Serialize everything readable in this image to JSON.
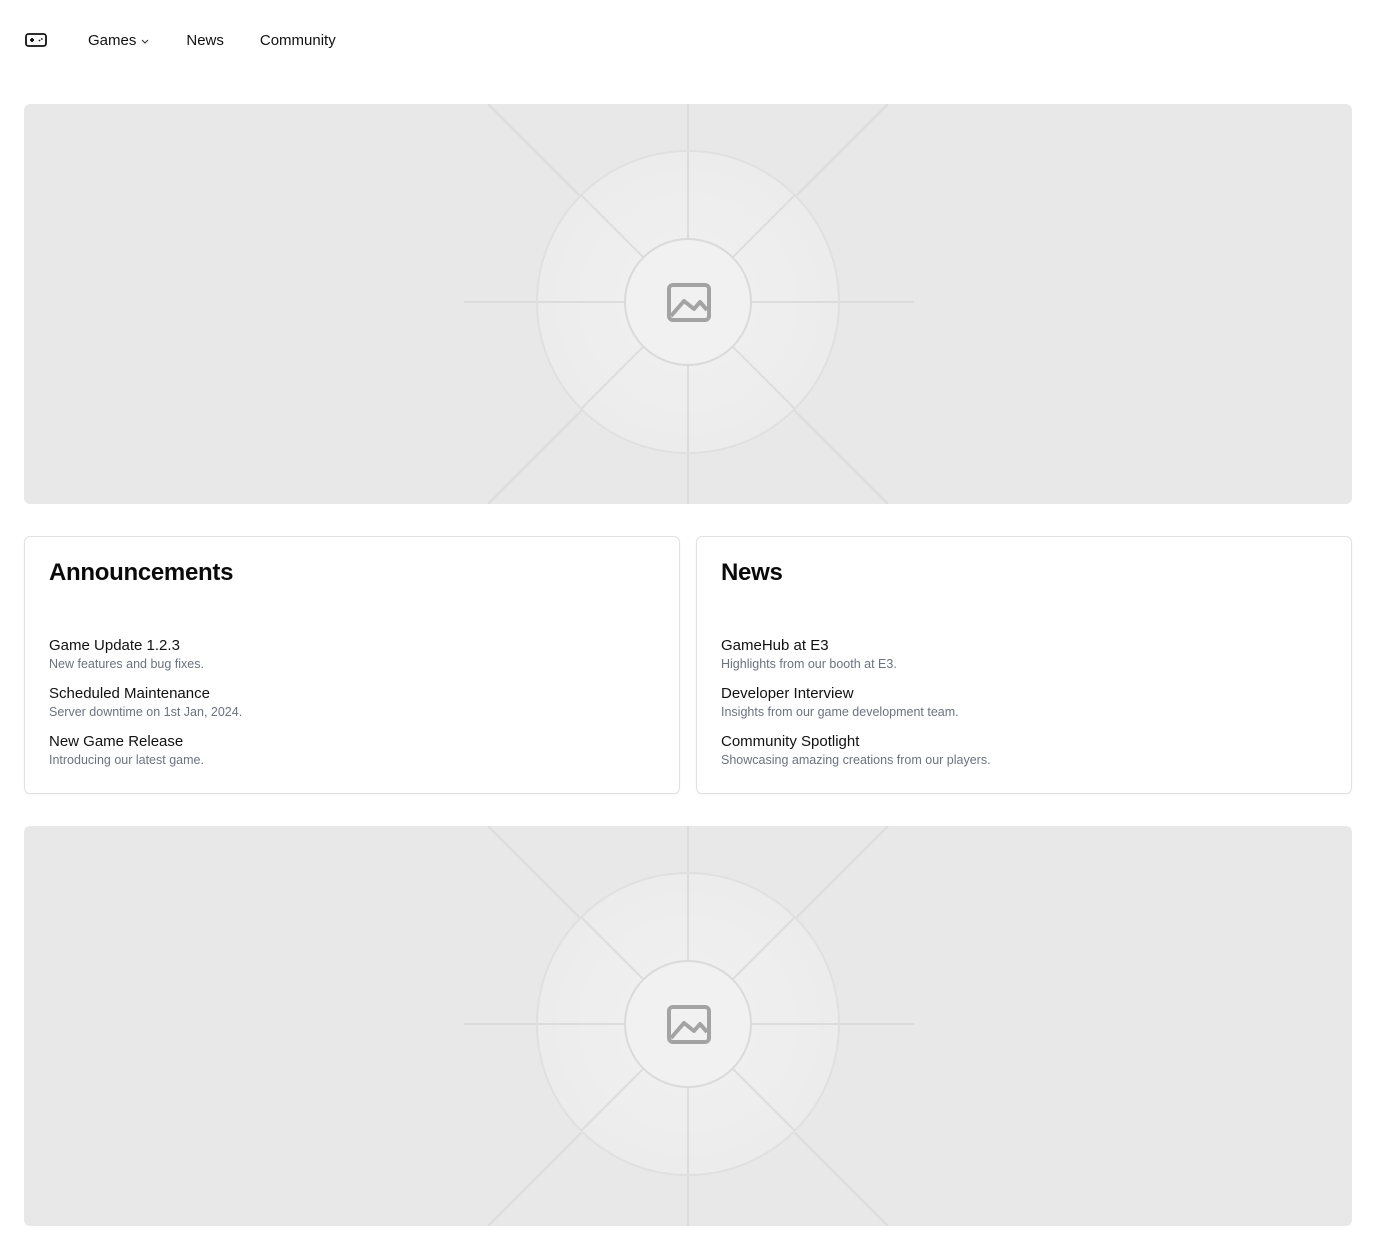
{
  "header": {
    "logo_icon": "gamepad-icon",
    "nav": [
      {
        "label": "Games",
        "has_dropdown": true
      },
      {
        "label": "News"
      },
      {
        "label": "Community"
      }
    ]
  },
  "hero_top": {
    "icon": "image-placeholder-icon"
  },
  "announcements": {
    "title": "Announcements",
    "items": [
      {
        "title": "Game Update 1.2.3",
        "desc": "New features and bug fixes."
      },
      {
        "title": "Scheduled Maintenance",
        "desc": "Server downtime on 1st Jan, 2024."
      },
      {
        "title": "New Game Release",
        "desc": "Introducing our latest game."
      }
    ]
  },
  "news": {
    "title": "News",
    "items": [
      {
        "title": "GameHub at E3",
        "desc": "Highlights from our booth at E3."
      },
      {
        "title": "Developer Interview",
        "desc": "Insights from our game development team."
      },
      {
        "title": "Community Spotlight",
        "desc": "Showcasing amazing creations from our players."
      }
    ]
  },
  "hero_bottom": {
    "icon": "image-placeholder-icon"
  },
  "colors": {
    "placeholder_bg": "#e8e8e8",
    "muted_text": "#6b7280",
    "card_border": "#e2e2e2"
  }
}
